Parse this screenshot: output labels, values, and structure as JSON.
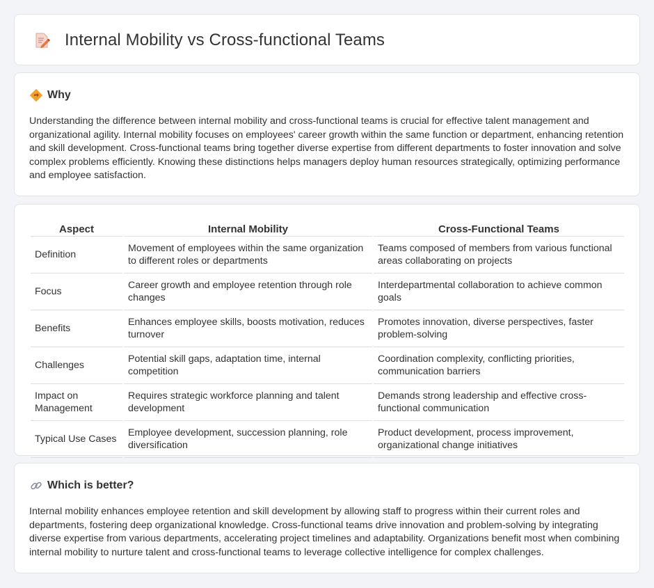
{
  "header": {
    "title": "Internal Mobility vs Cross-functional Teams",
    "icon": "document-pencil-icon"
  },
  "why": {
    "title": "Why",
    "icon": "diamond-arrow-icon",
    "body": "Understanding the difference between internal mobility and cross-functional teams is crucial for effective talent management and organizational agility. Internal mobility focuses on employees' career growth within the same function or department, enhancing retention and skill development. Cross-functional teams bring together diverse expertise from different departments to foster innovation and solve complex problems efficiently. Knowing these distinctions helps managers deploy human resources strategically, optimizing performance and employee satisfaction."
  },
  "table": {
    "headers": [
      "Aspect",
      "Internal Mobility",
      "Cross-Functional Teams"
    ],
    "rows": [
      [
        "Definition",
        "Movement of employees within the same organization to different roles or departments",
        "Teams composed of members from various functional areas collaborating on projects"
      ],
      [
        "Focus",
        "Career growth and employee retention through role changes",
        "Interdepartmental collaboration to achieve common goals"
      ],
      [
        "Benefits",
        "Enhances employee skills, boosts motivation, reduces turnover",
        "Promotes innovation, diverse perspectives, faster problem-solving"
      ],
      [
        "Challenges",
        "Potential skill gaps, adaptation time, internal competition",
        "Coordination complexity, conflicting priorities, communication barriers"
      ],
      [
        "Impact on Management",
        "Requires strategic workforce planning and talent development",
        "Demands strong leadership and effective cross-functional communication"
      ],
      [
        "Typical Use Cases",
        "Employee development, succession planning, role diversification",
        "Product development, process improvement, organizational change initiatives"
      ]
    ]
  },
  "better": {
    "title": "Which is better?",
    "icon": "link-icon",
    "body": "Internal mobility enhances employee retention and skill development by allowing staff to progress within their current roles and departments, fostering deep organizational knowledge. Cross-functional teams drive innovation and problem-solving by integrating diverse expertise from various departments, accelerating project timelines and adaptability. Organizations benefit most when combining internal mobility to nurture talent and cross-functional teams to leverage collective intelligence for complex challenges."
  },
  "colors": {
    "page_bg": "#f3f4f8",
    "card_bg": "#ffffff",
    "icon_orange": "#f0a030",
    "icon_red": "#e0584a"
  }
}
